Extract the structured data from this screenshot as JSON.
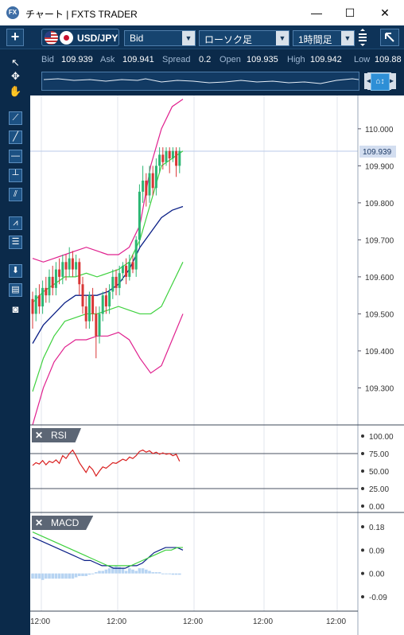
{
  "window": {
    "title": "チャート | FXTS TRADER",
    "app_icon": "FX",
    "minimize": "—",
    "maximize": "☐",
    "close": "✕"
  },
  "toolbar": {
    "add_icon": "+",
    "symbol": "USD/JPY",
    "price_type": "Bid",
    "chart_type": "ローソク足",
    "timeframe": "1時間足",
    "menu_icon": "menu-lines-icon",
    "expand_icon": "expand-arrow-icon"
  },
  "quote": {
    "bid_label": "Bid",
    "bid": "109.939",
    "ask_label": "Ask",
    "ask": "109.941",
    "spread_label": "Spread",
    "spread": "0.2",
    "open_label": "Open",
    "open": "109.935",
    "high_label": "High",
    "high": "109.942",
    "low_label": "Low",
    "low": "109.88"
  },
  "tools": [
    "cursor-icon",
    "crosshair-icon",
    "hand-icon",
    "trendline-icon",
    "line-icon",
    "horizontal-line-icon",
    "vertical-line-icon",
    "channel-icon",
    "fan-icon",
    "fibonacci-icon",
    "download-icon",
    "list-icon",
    "camera-icon"
  ],
  "colors": {
    "bull": "#2bb673",
    "bear": "#d93535",
    "bollinger_outer": "#e0208e",
    "bollinger_inner": "#3ed13e",
    "moving_average": "#0a1f86",
    "rsi": "#d92020",
    "macd": "#0a1f86",
    "signal": "#3ed13e",
    "histogram": "#b7d4f2"
  },
  "price_axis": {
    "ticks": [
      "110.000",
      "109.900",
      "109.800",
      "109.700",
      "109.600",
      "109.500",
      "109.400",
      "109.300"
    ],
    "current_label": "109.939"
  },
  "time_axis": {
    "ticks": [
      "12:00",
      "12:00",
      "12:00",
      "12:00",
      "12:00"
    ]
  },
  "rsi_panel": {
    "label": "RSI",
    "ticks": [
      "100.00",
      "75.00",
      "50.00",
      "25.00",
      "0.00"
    ]
  },
  "macd_panel": {
    "label": "MACD",
    "ticks": [
      "0.18",
      "0.09",
      "0.00",
      "-0.09"
    ]
  },
  "chart_data": [
    {
      "type": "candlestick",
      "ylim": [
        109.23,
        110.09
      ],
      "candles": [
        [
          109.54,
          109.5,
          109.56,
          109.46
        ],
        [
          109.5,
          109.55,
          109.57,
          109.48
        ],
        [
          109.55,
          109.52,
          109.58,
          109.5
        ],
        [
          109.52,
          109.57,
          109.59,
          109.5
        ],
        [
          109.57,
          109.55,
          109.6,
          109.53
        ],
        [
          109.55,
          109.6,
          109.62,
          109.53
        ],
        [
          109.6,
          109.57,
          109.63,
          109.55
        ],
        [
          109.57,
          109.62,
          109.64,
          109.55
        ],
        [
          109.62,
          109.6,
          109.65,
          109.58
        ],
        [
          109.6,
          109.64,
          109.66,
          109.58
        ],
        [
          109.64,
          109.62,
          109.66,
          109.59
        ],
        [
          109.62,
          109.65,
          109.68,
          109.6
        ],
        [
          109.65,
          109.62,
          109.67,
          109.6
        ],
        [
          109.62,
          109.64,
          109.66,
          109.6
        ],
        [
          109.64,
          109.58,
          109.65,
          109.55
        ],
        [
          109.58,
          109.52,
          109.6,
          109.5
        ],
        [
          109.52,
          109.48,
          109.55,
          109.46
        ],
        [
          109.48,
          109.55,
          109.56,
          109.46
        ],
        [
          109.55,
          109.5,
          109.57,
          109.48
        ],
        [
          109.5,
          109.44,
          109.52,
          109.38
        ],
        [
          109.44,
          109.5,
          109.52,
          109.42
        ],
        [
          109.5,
          109.55,
          109.56,
          109.48
        ],
        [
          109.55,
          109.52,
          109.57,
          109.5
        ],
        [
          109.52,
          109.56,
          109.58,
          109.5
        ],
        [
          109.56,
          109.6,
          109.62,
          109.54
        ],
        [
          109.6,
          109.57,
          109.62,
          109.55
        ],
        [
          109.57,
          109.61,
          109.63,
          109.55
        ],
        [
          109.61,
          109.63,
          109.64,
          109.59
        ],
        [
          109.63,
          109.6,
          109.65,
          109.58
        ],
        [
          109.6,
          109.64,
          109.66,
          109.59
        ],
        [
          109.64,
          109.62,
          109.66,
          109.61
        ],
        [
          109.62,
          109.7,
          109.71,
          109.6
        ],
        [
          109.7,
          109.83,
          109.85,
          109.68
        ],
        [
          109.83,
          109.86,
          109.9,
          109.8
        ],
        [
          109.86,
          109.82,
          109.88,
          109.79
        ],
        [
          109.82,
          109.88,
          109.9,
          109.8
        ],
        [
          109.88,
          109.84,
          109.9,
          109.82
        ],
        [
          109.84,
          109.9,
          109.92,
          109.82
        ],
        [
          109.9,
          109.93,
          109.95,
          109.88
        ],
        [
          109.93,
          109.91,
          109.95,
          109.89
        ],
        [
          109.91,
          109.94,
          109.95,
          109.9
        ],
        [
          109.94,
          109.92,
          109.95,
          109.88
        ],
        [
          109.92,
          109.94,
          109.95,
          109.91
        ],
        [
          109.94,
          109.9,
          109.95,
          109.87
        ],
        [
          109.9,
          109.94,
          109.95,
          109.88
        ]
      ]
    }
  ]
}
